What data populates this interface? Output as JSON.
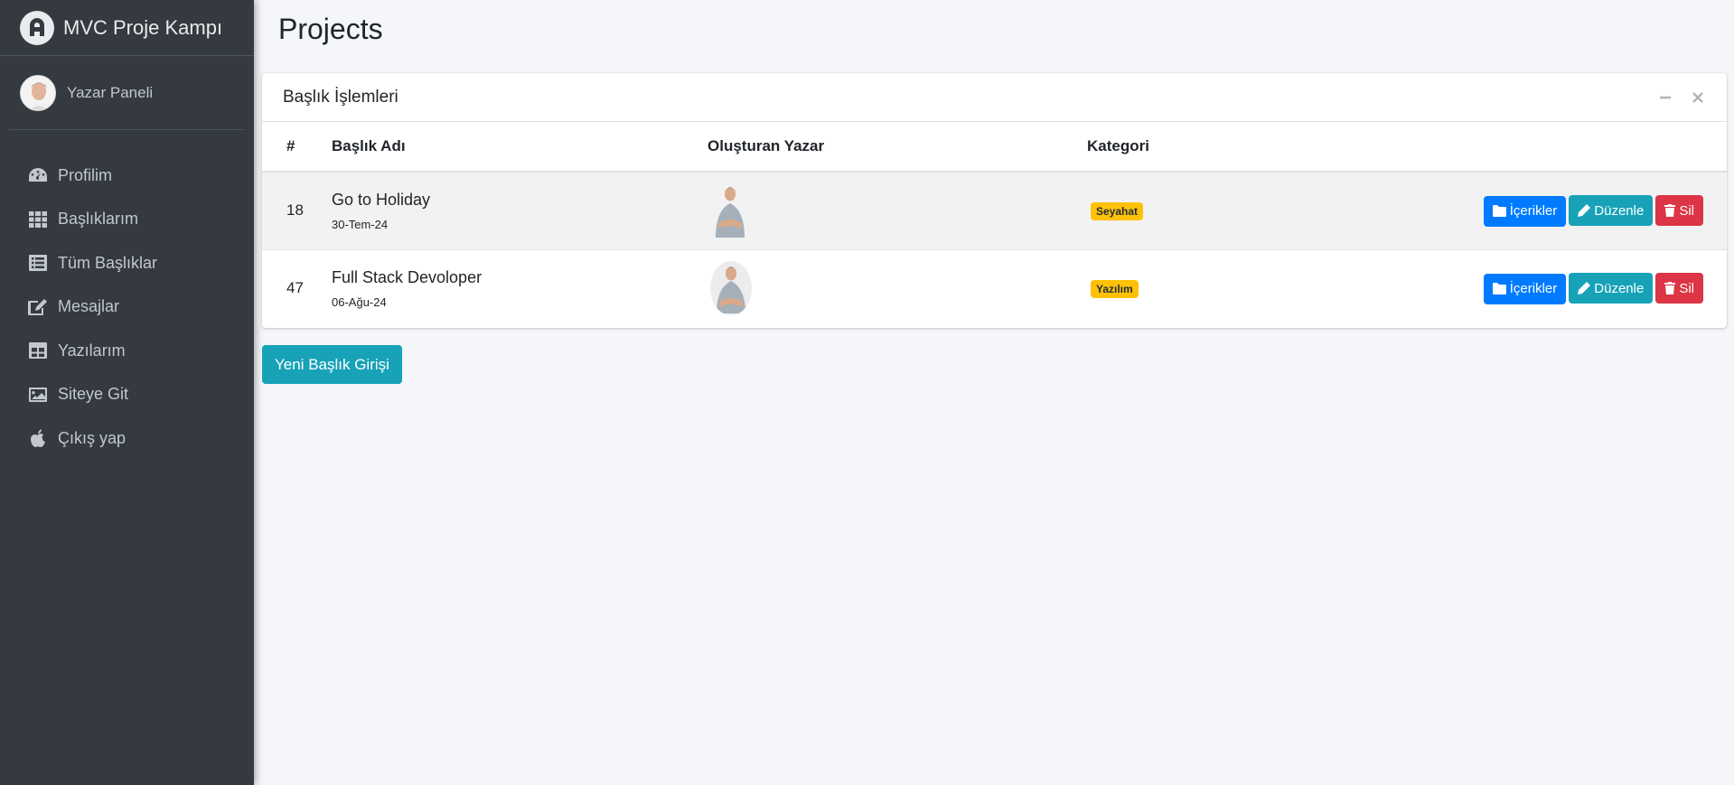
{
  "brand": {
    "name": "MVC Proje Kampı",
    "logo_icon": "brand-logo-icon"
  },
  "user": {
    "name": "Yazar Paneli"
  },
  "sidebar": {
    "items": [
      {
        "label": "Profilim",
        "icon": "tachometer-icon"
      },
      {
        "label": "Başlıklarım",
        "icon": "grid-icon"
      },
      {
        "label": "Tüm Başlıklar",
        "icon": "list-icon"
      },
      {
        "label": "Mesajlar",
        "icon": "edit-icon"
      },
      {
        "label": "Yazılarım",
        "icon": "table-icon"
      },
      {
        "label": "Siteye Git",
        "icon": "image-icon"
      },
      {
        "label": "Çıkış yap",
        "icon": "apple-icon"
      }
    ]
  },
  "page": {
    "title": "Projects"
  },
  "card": {
    "title": "Başlık İşlemleri"
  },
  "table": {
    "headers": {
      "id": "#",
      "title": "Başlık Adı",
      "author": "Oluşturan Yazar",
      "category": "Kategori"
    },
    "rows": [
      {
        "id": "18",
        "title": "Go to Holiday",
        "date": "30-Tem-24",
        "category": "Seyahat"
      },
      {
        "id": "47",
        "title": "Full Stack Devoloper",
        "date": "06-Ağu-24",
        "category": "Yazılım"
      }
    ]
  },
  "actions": {
    "contents": "İçerikler",
    "edit": "Düzenle",
    "delete": "Sil"
  },
  "new_button": "Yeni Başlık Girişi",
  "colors": {
    "sidebar_bg": "#343a40",
    "primary": "#007bff",
    "info": "#17a2b8",
    "danger": "#dc3545",
    "warning": "#ffc107"
  }
}
